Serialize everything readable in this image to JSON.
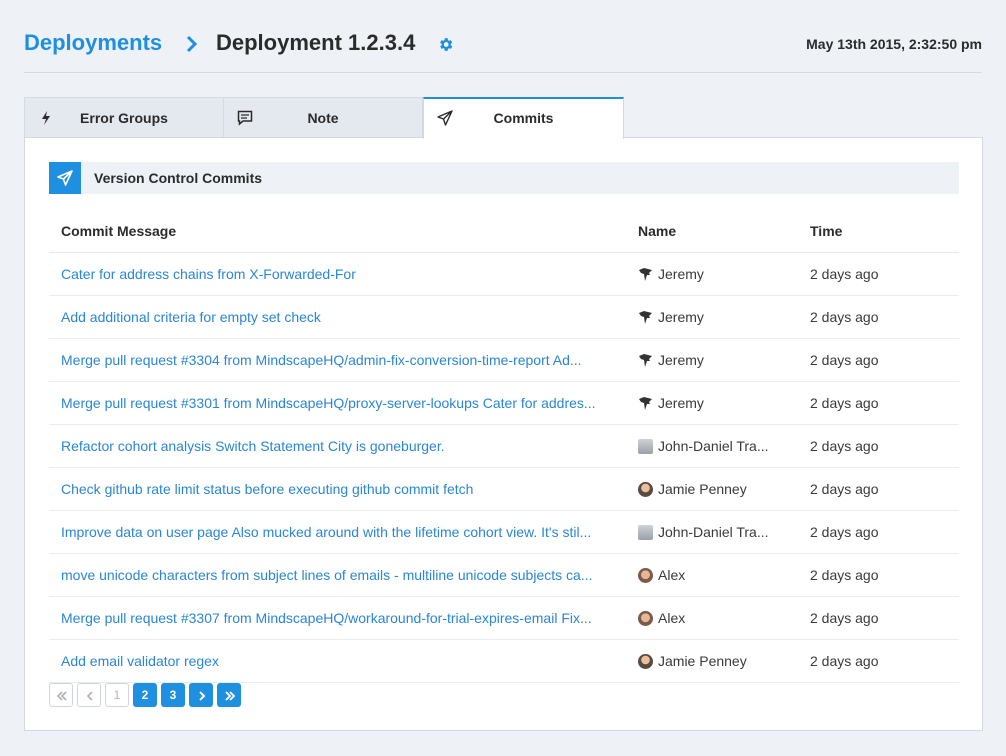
{
  "header": {
    "breadcrumb_root": "Deployments",
    "title": "Deployment 1.2.3.4",
    "timestamp": "May 13th 2015, 2:32:50 pm"
  },
  "tabs": [
    {
      "label": "Error Groups",
      "icon": "lightning-icon"
    },
    {
      "label": "Note",
      "icon": "note-icon"
    },
    {
      "label": "Commits",
      "icon": "paper-plane-icon",
      "active": true
    }
  ],
  "section": {
    "title": "Version Control Commits",
    "icon": "paper-plane-icon"
  },
  "table": {
    "columns": [
      "Commit Message",
      "Name",
      "Time"
    ],
    "rows": [
      {
        "message": "Cater for address chains from X-Forwarded-For",
        "name": "Jeremy",
        "time": "2 days ago",
        "avatar": "jeremy"
      },
      {
        "message": "Add additional criteria for empty set check",
        "name": "Jeremy",
        "time": "2 days ago",
        "avatar": "jeremy"
      },
      {
        "message": "Merge pull request #3304 from MindscapeHQ/admin-fix-conversion-time-report Ad...",
        "name": "Jeremy",
        "time": "2 days ago",
        "avatar": "jeremy"
      },
      {
        "message": "Merge pull request #3301 from MindscapeHQ/proxy-server-lookups Cater for addres...",
        "name": "Jeremy",
        "time": "2 days ago",
        "avatar": "jeremy"
      },
      {
        "message": "Refactor cohort analysis Switch Statement City is goneburger.",
        "name": "John-Daniel Tra...",
        "time": "2 days ago",
        "avatar": "john"
      },
      {
        "message": "Check github rate limit status before executing github commit fetch",
        "name": "Jamie Penney",
        "time": "2 days ago",
        "avatar": "jamie"
      },
      {
        "message": "Improve data on user page Also mucked around with the lifetime cohort view. It's stil...",
        "name": "John-Daniel Tra...",
        "time": "2 days ago",
        "avatar": "john"
      },
      {
        "message": "move unicode characters from subject lines of emails - multiline unicode subjects ca...",
        "name": "Alex",
        "time": "2 days ago",
        "avatar": "alex"
      },
      {
        "message": "Merge pull request #3307 from MindscapeHQ/workaround-for-trial-expires-email Fix...",
        "name": "Alex",
        "time": "2 days ago",
        "avatar": "alex"
      },
      {
        "message": "Add email validator regex",
        "name": "Jamie Penney",
        "time": "2 days ago",
        "avatar": "jamie"
      }
    ]
  },
  "pagination": {
    "pages": [
      "1",
      "2",
      "3"
    ],
    "current": "1"
  },
  "colors": {
    "accent": "#1f8fe0",
    "link": "#2a86d6",
    "background": "#eef1f6"
  }
}
